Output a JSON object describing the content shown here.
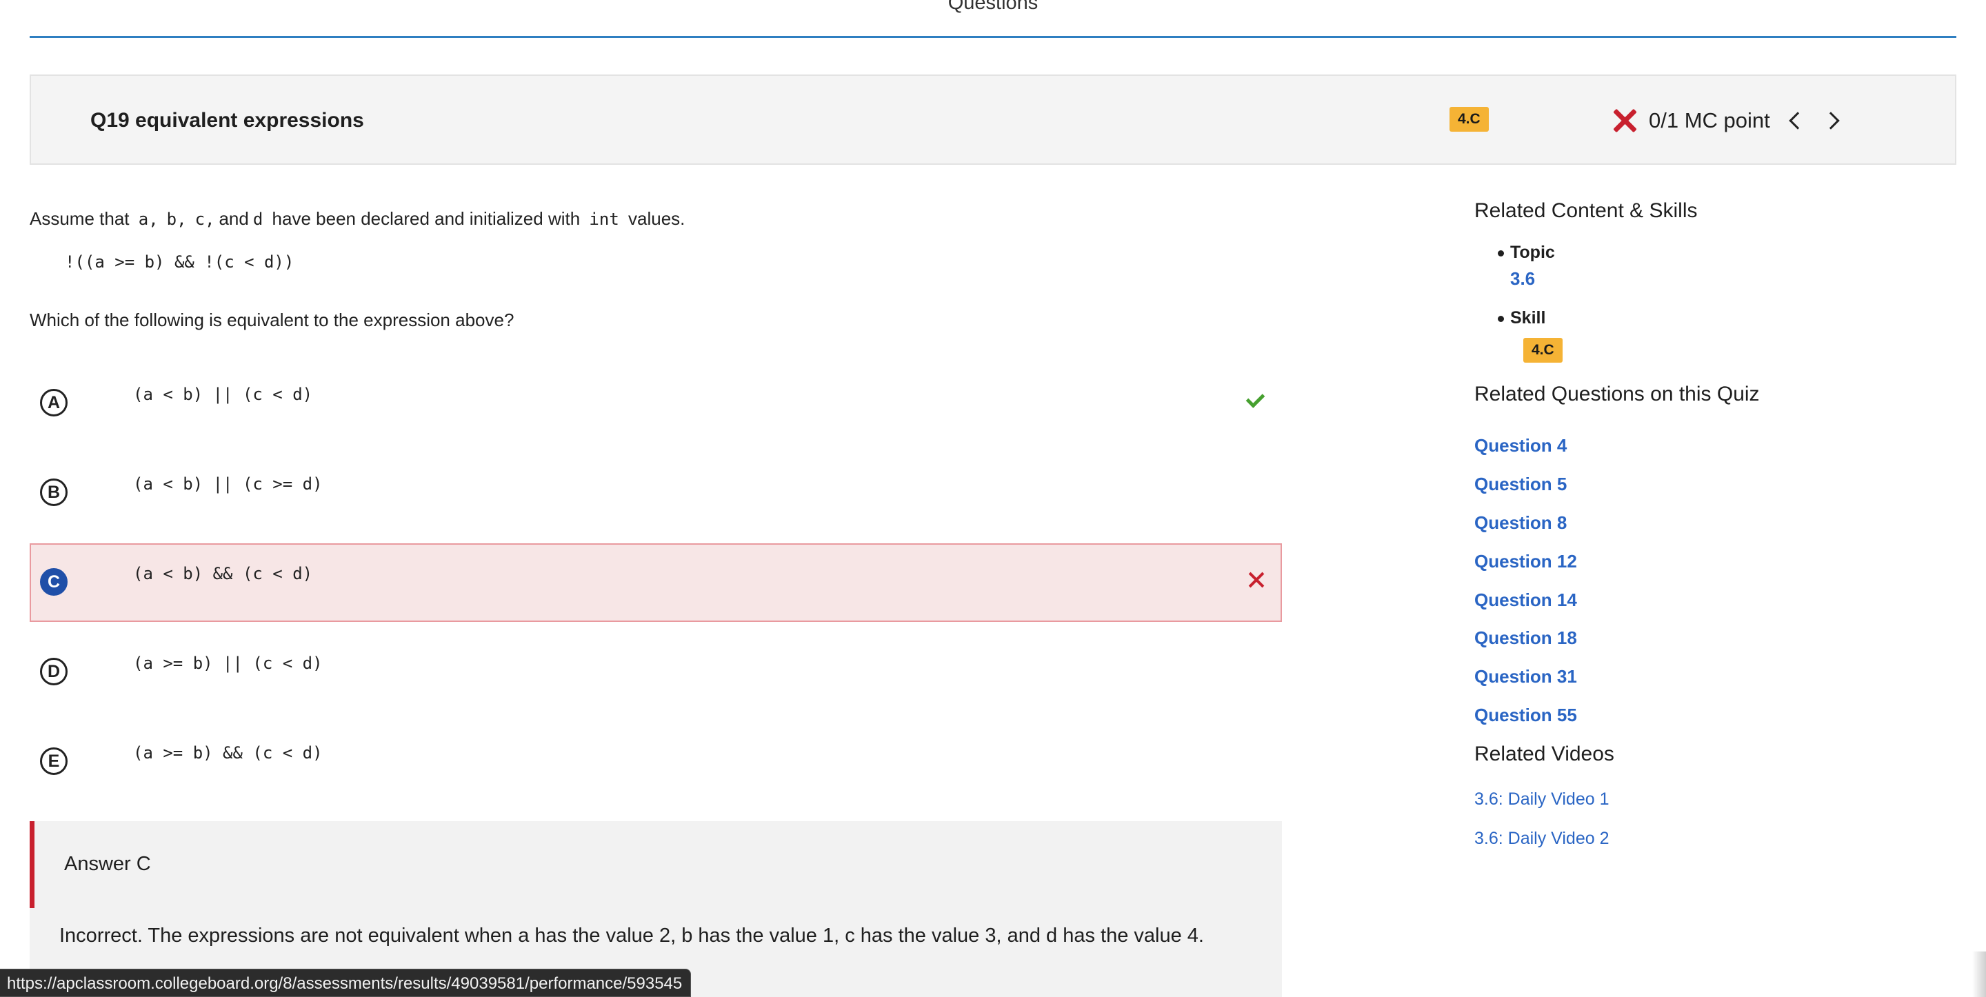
{
  "page": {
    "heading": "Questions"
  },
  "question_header": {
    "title": "Q19 equivalent expressions",
    "skill_badge": "4.C",
    "score": "0/1 MC point"
  },
  "stem": {
    "before_vars": "Assume that",
    "vars": [
      "a,",
      "b,",
      "c,",
      "and",
      "d"
    ],
    "after_vars": "have been declared and initialized with",
    "type_code": "int",
    "after_type": "values.",
    "expression": "!((a >= b) && !(c < d))",
    "question": "Which of the following is equivalent to the expression above?"
  },
  "options": [
    {
      "letter": "A",
      "code": "(a < b) || (c < d)",
      "mark": "correct"
    },
    {
      "letter": "B",
      "code": "(a < b) || (c >= d)",
      "mark": ""
    },
    {
      "letter": "C",
      "code": "(a < b) && (c < d)",
      "mark": "incorrect-selected"
    },
    {
      "letter": "D",
      "code": "(a >= b) || (c < d)",
      "mark": ""
    },
    {
      "letter": "E",
      "code": "(a >= b) && (c < d)",
      "mark": ""
    }
  ],
  "answer": {
    "title": "Answer C",
    "explanation": "Incorrect. The expressions are not equivalent when a has the value 2, b has the value 1, c has the value 3, and d has the value 4."
  },
  "sidebar": {
    "related_heading": "Related Content & Skills",
    "topic_label": "Topic",
    "topic_value": "3.6",
    "skill_label": "Skill",
    "skill_value": "4.C",
    "questions_heading": "Related Questions on this Quiz",
    "questions": [
      "Question 4",
      "Question 5",
      "Question 8",
      "Question 12",
      "Question 14",
      "Question 18",
      "Question 31",
      "Question 55"
    ],
    "videos_heading": "Related Videos",
    "videos": [
      "3.6: Daily Video 1",
      "3.6: Daily Video 2"
    ]
  },
  "status_bar": {
    "url": "https://apclassroom.collegeboard.org/8/assessments/results/49039581/performance/593545"
  },
  "colors": {
    "accent_blue": "#2a65c4",
    "badge": "#f5b335",
    "error_red": "#c8202e",
    "correct_green": "#46a02f"
  }
}
